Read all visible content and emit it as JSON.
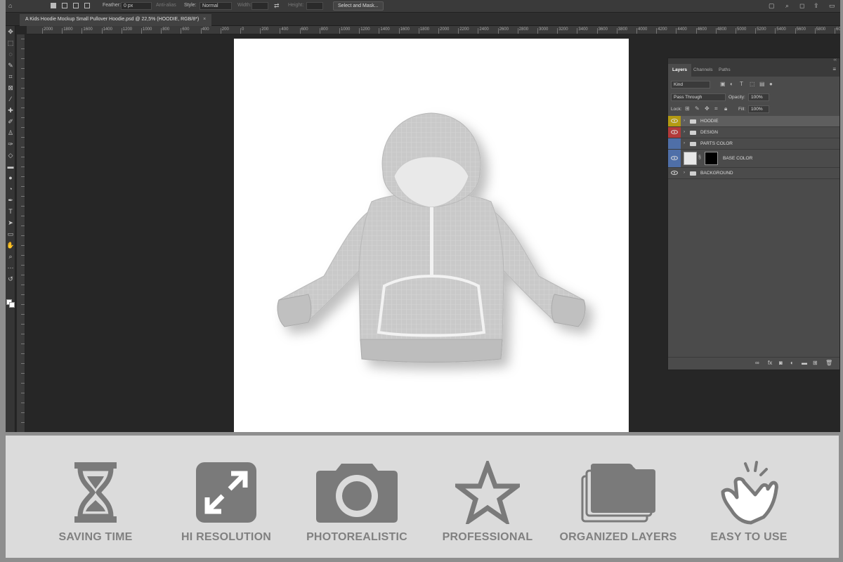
{
  "options_bar": {
    "feather_label": "Feather:",
    "feather_value": "0 px",
    "antialias_label": "Anti-alias",
    "style_label": "Style:",
    "style_value": "Normal",
    "width_label": "Width:",
    "height_label": "Height:",
    "select_mask_label": "Select and Mask..."
  },
  "document_tab": {
    "title": "A Kids Hoodie Mockup Small Pullover Hoodie.psd @ 22,5% (HOODIE, RGB/8*)",
    "close": "×"
  },
  "ruler_labels": [
    "2000",
    "1800",
    "1600",
    "1400",
    "1200",
    "1000",
    "800",
    "600",
    "400",
    "200",
    "0",
    "200",
    "400",
    "600",
    "800",
    "1000",
    "1200",
    "1400",
    "1600",
    "1800",
    "2000",
    "2200",
    "2400",
    "2600",
    "2800",
    "3000",
    "3200",
    "3400",
    "3600",
    "3800",
    "4000",
    "4200",
    "4400",
    "4600",
    "4800",
    "5000",
    "5200",
    "5400",
    "5600",
    "5800",
    "6000"
  ],
  "layers_panel": {
    "tabs": [
      "Layers",
      "Channels",
      "Paths"
    ],
    "kind_label": "Kind",
    "blend_mode": "Pass Through",
    "opacity_label": "Opacity:",
    "opacity_value": "100%",
    "lock_label": "Lock:",
    "fill_label": "Fill:",
    "fill_value": "100%",
    "layers": [
      {
        "name": "HOODIE",
        "tag_color": "#b49a12",
        "type": "group",
        "visible": true,
        "selected": true
      },
      {
        "name": "DESIGN",
        "tag_color": "#b33a3a",
        "type": "group",
        "visible": true,
        "selected": false
      },
      {
        "name": "PARTS COLOR",
        "tag_color": "#4f6fa8",
        "type": "group",
        "visible": false,
        "selected": false
      },
      {
        "name": "BASE COLOR",
        "tag_color": "#4f6fa8",
        "type": "smart",
        "visible": true,
        "selected": false
      },
      {
        "name": "BACKGROUND",
        "tag_color": "",
        "type": "group",
        "visible": true,
        "selected": false
      }
    ]
  },
  "features": [
    {
      "label": "SAVING TIME",
      "icon": "hourglass-icon"
    },
    {
      "label": "HI RESOLUTION",
      "icon": "expand-arrows-icon"
    },
    {
      "label": "PHOTOREALISTIC",
      "icon": "camera-icon"
    },
    {
      "label": "PROFESSIONAL",
      "icon": "star-icon"
    },
    {
      "label": "ORGANIZED LAYERS",
      "icon": "layers-icon"
    },
    {
      "label": "EASY TO USE",
      "icon": "tap-hand-icon"
    }
  ],
  "colors": {
    "icon_gray": "#7a7a7a",
    "canvas_bg": "#ffffff",
    "workspace_bg": "#262626"
  }
}
